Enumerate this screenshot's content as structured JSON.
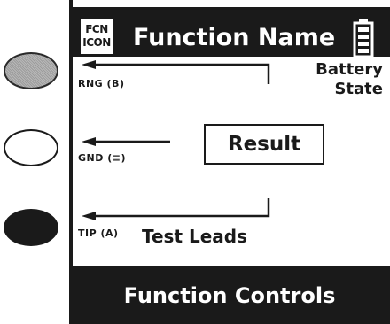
{
  "buttons": [
    {
      "name": "button-gray",
      "style": "gray"
    },
    {
      "name": "button-white",
      "style": "white"
    },
    {
      "name": "button-black",
      "style": "black"
    }
  ],
  "header": {
    "icon_line1": "FCN",
    "icon_line2": "ICON",
    "function_name": "Function Name",
    "battery_icon": "battery-icon"
  },
  "labels": {
    "rng": "RNG (B)",
    "gnd": "GND (≡)",
    "tip": "TIP (A)",
    "battery_line1": "Battery",
    "battery_line2": "State",
    "test_leads": "Test Leads",
    "result": "Result"
  },
  "footer": {
    "function_controls": "Function Controls"
  },
  "colors": {
    "dark": "#1a1a1a",
    "gray_button": "#a8a8a8",
    "white": "#ffffff"
  }
}
